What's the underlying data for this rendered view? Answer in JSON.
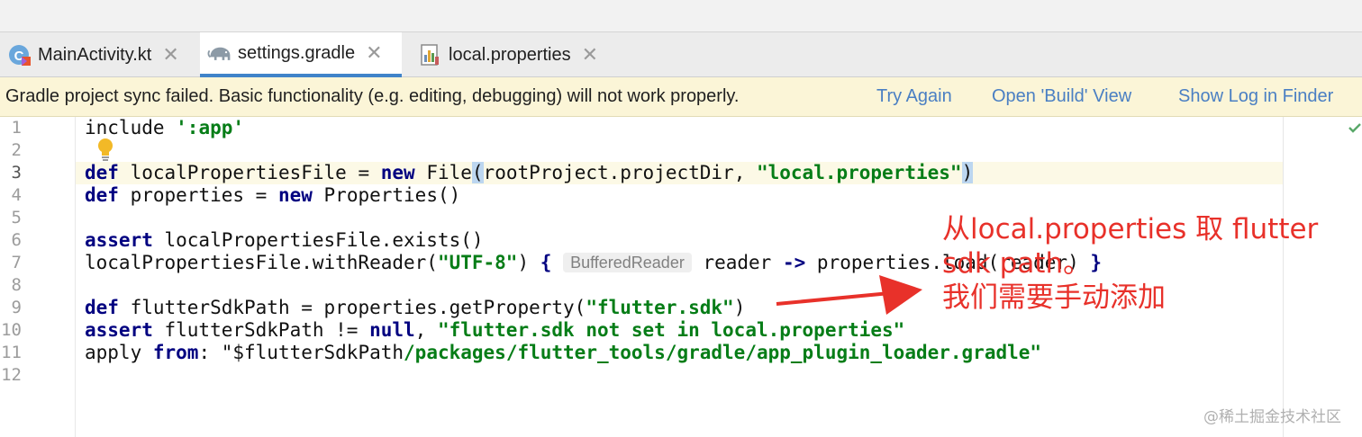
{
  "tabs": [
    {
      "label": "MainActivity.kt",
      "icon": "kotlin-activity-icon",
      "active": false
    },
    {
      "label": "settings.gradle",
      "icon": "gradle-elephant-icon",
      "active": true
    },
    {
      "label": "local.properties",
      "icon": "properties-file-icon",
      "active": false
    }
  ],
  "banner": {
    "message": "Gradle project sync failed. Basic functionality (e.g. editing, debugging) will not work properly.",
    "try_again": "Try Again",
    "open_build": "Open 'Build' View",
    "show_log": "Show Log in Finder"
  },
  "editor": {
    "line_numbers": [
      "1",
      "2",
      "3",
      "4",
      "5",
      "6",
      "7",
      "8",
      "9",
      "10",
      "11",
      "12"
    ],
    "code": {
      "l1_a": "include ",
      "l1_b": "':app'",
      "l3_kw1": "def",
      "l3_a": " localPropertiesFile = ",
      "l3_kw2": "new",
      "l3_b": " File",
      "l3_p1": "(",
      "l3_c": "rootProject.projectDir, ",
      "l3_str": "\"local.properties\"",
      "l3_p2": ")",
      "l4_kw1": "def",
      "l4_a": " properties = ",
      "l4_kw2": "new",
      "l4_b": " Properties()",
      "l6_kw": "assert",
      "l6_a": " localPropertiesFile.exists()",
      "l7_a": "localPropertiesFile.withReader(",
      "l7_str": "\"UTF-8\"",
      "l7_b": ") ",
      "l7_brace": "{",
      "l7_hint": "BufferedReader",
      "l7_c": " reader ",
      "l7_arrow": "->",
      "l7_d": " properties.load(reader) ",
      "l7_close": "}",
      "l9_kw": "def",
      "l9_a": " flutterSdkPath = properties.getProperty(",
      "l9_str": "\"flutter.sdk\"",
      "l9_b": ")",
      "l10_kw": "assert",
      "l10_a": " flutterSdkPath != ",
      "l10_kw2": "null",
      "l10_b": ", ",
      "l10_str": "\"flutter.sdk not set in local.properties\"",
      "l11_a": "apply ",
      "l11_kw": "from",
      "l11_b": ": ",
      "l11_q": "\"$flutterSdkPath",
      "l11_str": "/packages/flutter_tools/gradle/app_plugin_loader.gradle\""
    }
  },
  "annotation": {
    "line1": "从local.properties 取 flutter",
    "line2": "sdk path。",
    "line3": "我们需要手动添加"
  },
  "watermark": "@稀土掘金技术社区",
  "colors": {
    "keyword": "#000080",
    "string": "#067d17",
    "link": "#4a7fc3",
    "banner_bg": "#fbf5d7",
    "annotation": "#e8312a",
    "tab_underline": "#4083c9"
  }
}
